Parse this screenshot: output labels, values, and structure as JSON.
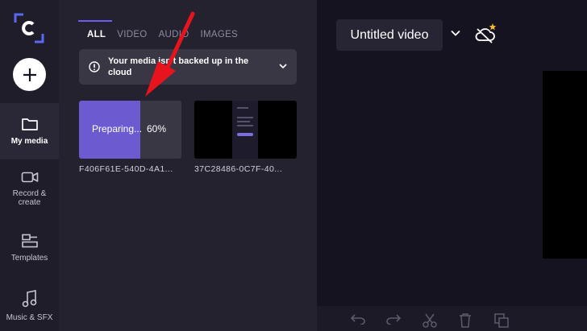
{
  "rail": {
    "items": [
      {
        "label": "My media",
        "icon": "folder-icon"
      },
      {
        "label": "Record & create",
        "icon": "camera-icon"
      },
      {
        "label": "Templates",
        "icon": "templates-icon"
      },
      {
        "label": "Music & SFX",
        "icon": "music-icon"
      }
    ]
  },
  "media": {
    "tabs": [
      "ALL",
      "VIDEO",
      "AUDIO",
      "IMAGES"
    ],
    "banner_text": "Your media isn't backed up in the cloud",
    "items": [
      {
        "status": "Preparing...",
        "progress_label": "60%",
        "progress": 0.6,
        "filename": "F406F61E-540D-4A1..."
      },
      {
        "filename": "37C28486-0C7F-40..."
      }
    ]
  },
  "editor": {
    "title": "Untitled video"
  },
  "colors": {
    "accent": "#6b5cf4",
    "annotation_arrow": "#e8141d",
    "cloud_star": "#f5b82e"
  }
}
